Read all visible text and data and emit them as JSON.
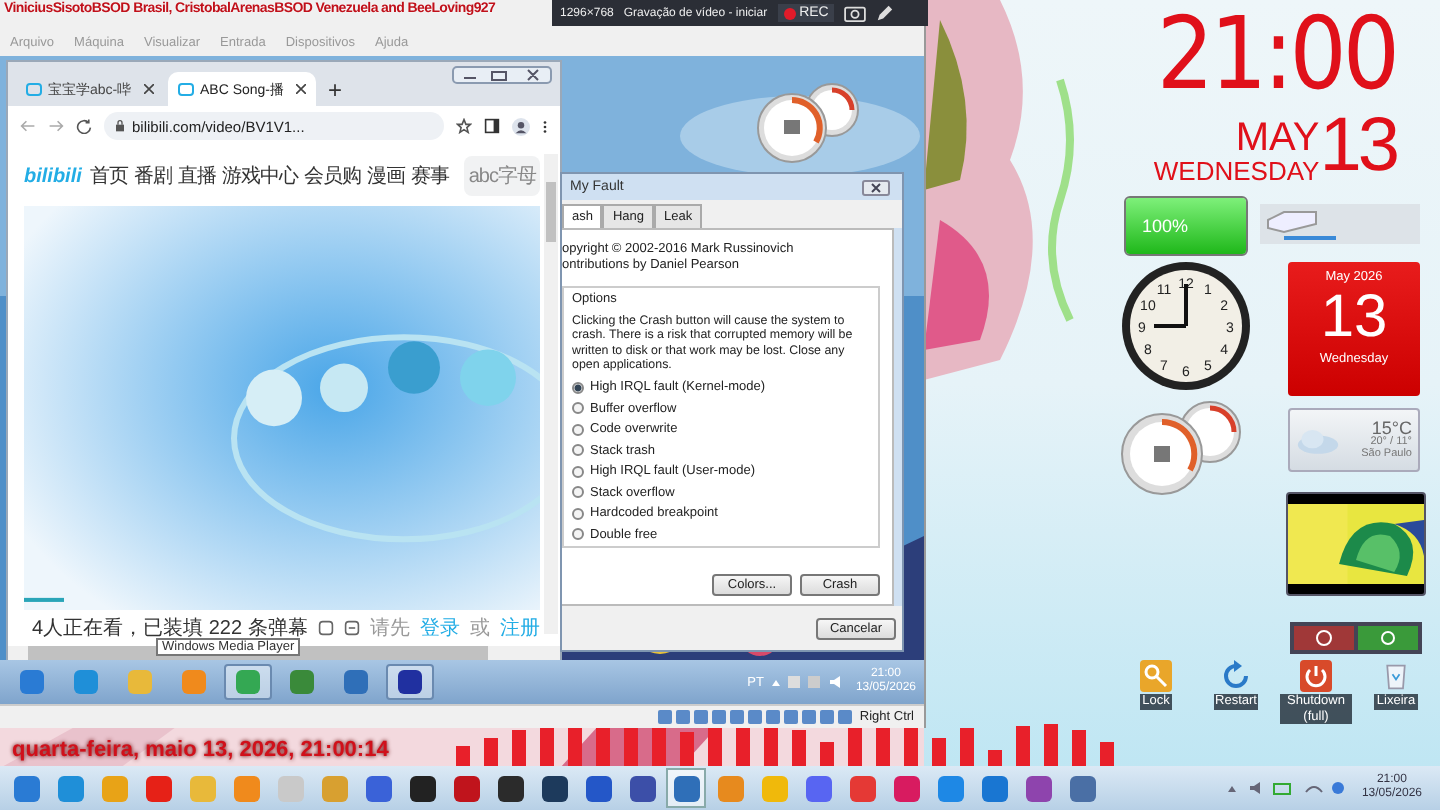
{
  "overlay_banner": "ViniciusSisotoBSOD Brasil, CristobalArenasBSOD Venezuela and BeeLoving927",
  "recorder_bar": {
    "resolution": "1296×768",
    "title": "Gravação de vídeo - iniciar",
    "record_label": "REC"
  },
  "vm_window": {
    "menu": [
      "Arquivo",
      "Máquina",
      "Visualizar",
      "Entrada",
      "Dispositivos",
      "Ajuda"
    ],
    "host_key": "Right Ctrl"
  },
  "browser": {
    "tabs": [
      {
        "title": "宝宝学abc-哔",
        "selected": false
      },
      {
        "title": "ABC Song-播",
        "selected": true
      }
    ],
    "new_tab": "+",
    "url": "bilibili.com/video/BV1V1...",
    "logo": "bilibili",
    "nav": [
      "首页",
      "番剧",
      "直播",
      "游戏中心",
      "会员购",
      "漫画",
      "赛事"
    ],
    "search_placeholder": "abc字母",
    "danmaku_status": "4人正在看，已装填 222 条弹幕",
    "prompt": "请先",
    "login": "登录",
    "or": "或",
    "register": "注册"
  },
  "tooltip": "Windows Media Player",
  "dialog": {
    "title": "My Fault",
    "tabs": [
      {
        "label": "ash",
        "selected": true
      },
      {
        "label": "Hang",
        "selected": false
      },
      {
        "label": "Leak",
        "selected": false
      }
    ],
    "copyright": "opyright © 2002-2016 Mark Russinovich",
    "contributors": "ontributions by Daniel Pearson",
    "group": "Options",
    "warning": "Clicking the Crash button will cause the system to crash. There is a risk that corrupted memory will be written to disk or that work may be lost. Close any open applications.",
    "options": [
      {
        "label": "High IRQL fault (Kernel-mode)",
        "selected": true
      },
      {
        "label": "Buffer overflow",
        "selected": false
      },
      {
        "label": "Code overwrite",
        "selected": false
      },
      {
        "label": "Stack trash",
        "selected": false
      },
      {
        "label": "High IRQL fault (User-mode)",
        "selected": false
      },
      {
        "label": "Stack overflow",
        "selected": false
      },
      {
        "label": "Hardcoded breakpoint",
        "selected": false
      },
      {
        "label": "Double free",
        "selected": false
      }
    ],
    "buttons": [
      "Colors...",
      "Crash"
    ],
    "cancel": "Cancelar"
  },
  "guest_taskbar": {
    "language": "PT",
    "time": "21:00",
    "date": "13/05/2026"
  },
  "host_clock": {
    "time": "21:00",
    "month": "MAY",
    "day": "13",
    "weekday": "WEDNESDAY"
  },
  "battery": {
    "reading": "100%",
    "level": 1
  },
  "analog_clock": {
    "numbers": [
      "11",
      "12",
      "1",
      "10",
      "2",
      "9",
      "3",
      "8",
      "4",
      "7",
      "6",
      "5"
    ]
  },
  "calendar": {
    "month": "May 2026",
    "day": "13",
    "weekday": "Wednesday"
  },
  "weather": {
    "temperature": "15°C",
    "range": "20° / 11°",
    "city": "São Paulo"
  },
  "desktop_icons": [
    {
      "label": "Lock",
      "kind": "lock"
    },
    {
      "label": "Restart",
      "kind": "restart"
    },
    {
      "label": "Shutdown (full)",
      "kind": "shutdown"
    },
    {
      "label": "Lixeira",
      "kind": "bin"
    }
  ],
  "date_overlay": "quarta-feira, maio 13, 2026, 21:00:14",
  "host_taskbar": {
    "time": "21:00",
    "date": "13/05/2026"
  }
}
